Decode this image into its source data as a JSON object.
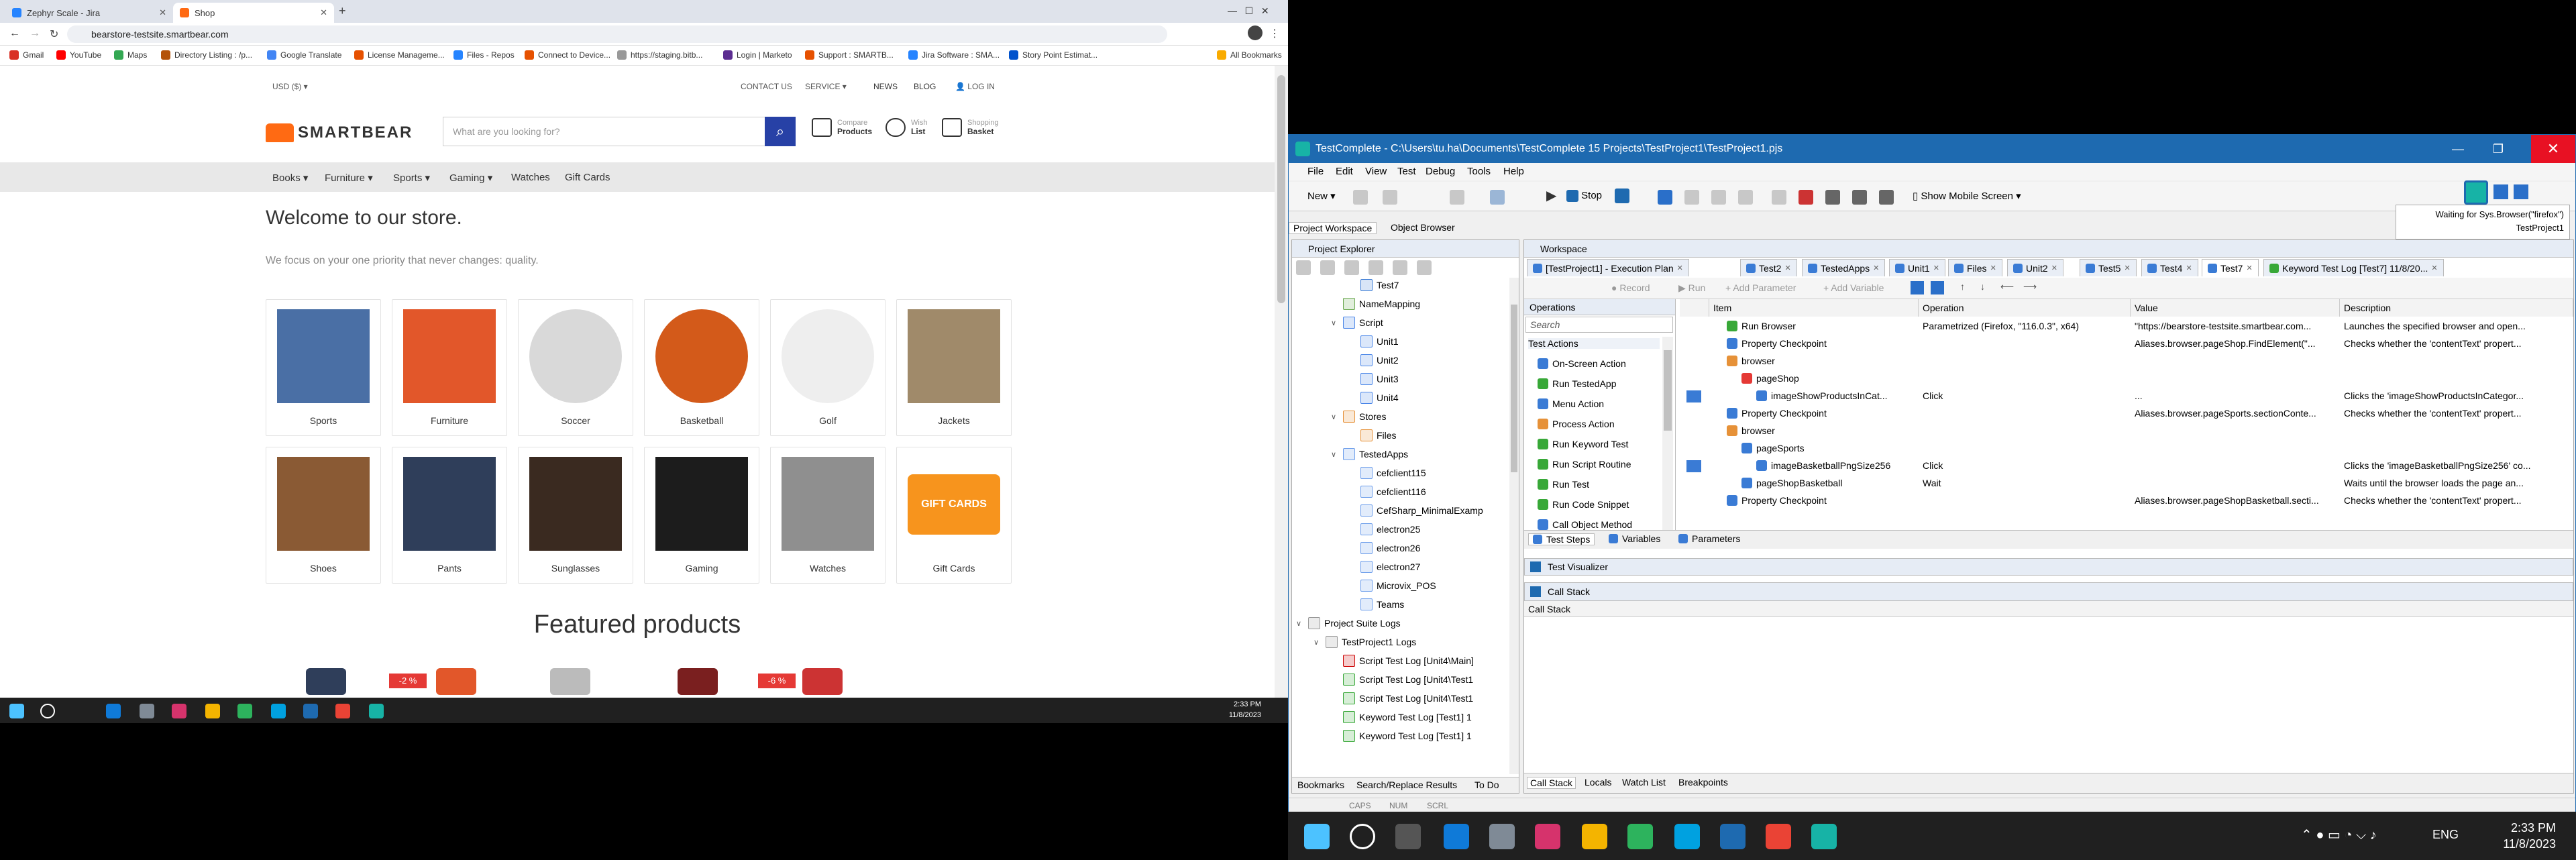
{
  "left": {
    "tabs": [
      {
        "label": "Zephyr Scale - Jira"
      },
      {
        "label": "Shop"
      }
    ],
    "url": "bearstore-testsite.smartbear.com",
    "bookmarks": [
      "Gmail",
      "YouTube",
      "Maps",
      "Directory Listing : /p...",
      "Google Translate",
      "License Manageme...",
      "Files - Repos",
      "Connect to Device...",
      "https://staging.bitb...",
      "Login | Marketo",
      "Support : SMARTB...",
      "Jira Software : SMA...",
      "Story Point Estimat..."
    ],
    "all_bookmarks": "All Bookmarks",
    "topbar": {
      "currency": "USD ($)",
      "contact": "CONTACT US",
      "service": "SERVICE",
      "news": "NEWS",
      "blog": "BLOG",
      "login": "LOG IN"
    },
    "logo": "SMARTBEAR",
    "search_placeholder": "What are you looking for?",
    "header_icons": [
      {
        "top": "Compare",
        "bottom": "Products"
      },
      {
        "top": "Wish",
        "bottom": "List"
      },
      {
        "top": "Shopping",
        "bottom": "Basket"
      }
    ],
    "nav": [
      "Books",
      "Furniture",
      "Sports",
      "Gaming",
      "Watches",
      "Gift Cards"
    ],
    "welcome": "Welcome to our store.",
    "subtitle": "We focus on your one priority that never changes: quality.",
    "categories": [
      {
        "label": "Sports",
        "color": "#4a6fa5"
      },
      {
        "label": "Furniture",
        "color": "#e2572a"
      },
      {
        "label": "Soccer",
        "color": "#d9d9d9"
      },
      {
        "label": "Basketball",
        "color": "#d35a1a"
      },
      {
        "label": "Golf",
        "color": "#eeeeee"
      },
      {
        "label": "Jackets",
        "color": "#a08a6a"
      },
      {
        "label": "Shoes",
        "color": "#8a5a34"
      },
      {
        "label": "Pants",
        "color": "#2f3e5a"
      },
      {
        "label": "Sunglasses",
        "color": "#3a2a20"
      },
      {
        "label": "Gaming",
        "color": "#1c1c1c"
      },
      {
        "label": "Watches",
        "color": "#8f8f8f"
      },
      {
        "label": "Gift Cards",
        "color": "#f7941d"
      }
    ],
    "gift_card_text": "GIFT CARDS",
    "featured": "Featured products",
    "discounts": [
      "-2 %",
      "-6 %"
    ],
    "taskbar_time": "2:33 PM",
    "taskbar_date": "11/8/2023"
  },
  "right": {
    "title": "TestComplete - C:\\Users\\tu.ha\\Documents\\TestComplete 15 Projects\\TestProject1\\TestProject1.pjs",
    "menu": [
      "File",
      "Edit",
      "View",
      "Test",
      "Debug",
      "Tools",
      "Help"
    ],
    "toolbar": {
      "new": "New",
      "stop": "Stop",
      "mobile": "Show Mobile Screen"
    },
    "hint_line1": "Waiting for Sys.Browser(\"firefox\")",
    "hint_line2": "TestProject1",
    "ws_tabs": [
      "Project Workspace",
      "Object Browser"
    ],
    "explorer_title": "Project Explorer",
    "workspace_title": "Workspace",
    "tree": [
      {
        "label": "Test7",
        "indent": 3,
        "tg": "",
        "color": "#3a7bd5"
      },
      {
        "label": "NameMapping",
        "indent": 2,
        "tg": "",
        "color": "#6aa84f"
      },
      {
        "label": "Script",
        "indent": 2,
        "tg": "∨",
        "color": "#4a86e8"
      },
      {
        "label": "Unit1",
        "indent": 3,
        "tg": "",
        "color": "#4a86e8"
      },
      {
        "label": "Unit2",
        "indent": 3,
        "tg": "",
        "color": "#4a86e8"
      },
      {
        "label": "Unit3",
        "indent": 3,
        "tg": "",
        "color": "#4a86e8"
      },
      {
        "label": "Unit4",
        "indent": 3,
        "tg": "",
        "color": "#4a86e8"
      },
      {
        "label": "Stores",
        "indent": 2,
        "tg": "∨",
        "color": "#e69138"
      },
      {
        "label": "Files",
        "indent": 3,
        "tg": "",
        "color": "#e69138"
      },
      {
        "label": "TestedApps",
        "indent": 2,
        "tg": "∨",
        "color": "#6d9eeb"
      },
      {
        "label": "cefclient115",
        "indent": 3,
        "tg": "",
        "color": "#6d9eeb"
      },
      {
        "label": "cefclient116",
        "indent": 3,
        "tg": "",
        "color": "#6d9eeb"
      },
      {
        "label": "CefSharp_MinimalExamp",
        "indent": 3,
        "tg": "",
        "color": "#6d9eeb"
      },
      {
        "label": "electron25",
        "indent": 3,
        "tg": "",
        "color": "#6d9eeb"
      },
      {
        "label": "electron26",
        "indent": 3,
        "tg": "",
        "color": "#6d9eeb"
      },
      {
        "label": "electron27",
        "indent": 3,
        "tg": "",
        "color": "#6d9eeb"
      },
      {
        "label": "Microvix_POS",
        "indent": 3,
        "tg": "",
        "color": "#6d9eeb"
      },
      {
        "label": "Teams",
        "indent": 3,
        "tg": "",
        "color": "#6d9eeb"
      },
      {
        "label": "Project Suite Logs",
        "indent": 0,
        "tg": "∨",
        "color": "#999999"
      },
      {
        "label": "TestProject1 Logs",
        "indent": 1,
        "tg": "∨",
        "color": "#999999"
      },
      {
        "label": "Script Test Log [Unit4\\Main]",
        "indent": 2,
        "tg": "",
        "color": "#cc0000"
      },
      {
        "label": "Script Test Log [Unit4\\Test1",
        "indent": 2,
        "tg": "",
        "color": "#38a838"
      },
      {
        "label": "Script Test Log [Unit4\\Test1",
        "indent": 2,
        "tg": "",
        "color": "#38a838"
      },
      {
        "label": "Keyword Test Log [Test1] 1",
        "indent": 2,
        "tg": "",
        "color": "#38a838"
      },
      {
        "label": "Keyword Test Log [Test1] 1",
        "indent": 2,
        "tg": "",
        "color": "#38a838"
      }
    ],
    "explorer_bottom_tabs": [
      "Bookmarks",
      "Search/Replace Results",
      "To Do"
    ],
    "doc_tabs": [
      "[TestProject1] - Execution Plan",
      "Test2",
      "TestedApps",
      "Unit1",
      "Files",
      "Unit2",
      "Test5",
      "Test4",
      "Test7",
      "Keyword Test Log [Test7] 11/8/20..."
    ],
    "kt_toolbar": [
      "Record",
      "Run",
      "Add Parameter",
      "Add Variable"
    ],
    "ops_title": "Operations",
    "ops_search": "Search",
    "ops": [
      {
        "label": "Test Actions",
        "group": true,
        "color": ""
      },
      {
        "label": "On-Screen Action",
        "group": false,
        "color": "#3a7bd5"
      },
      {
        "label": "Run TestedApp",
        "group": false,
        "color": "#38a838"
      },
      {
        "label": "Menu Action",
        "group": false,
        "color": "#3a7bd5"
      },
      {
        "label": "Process Action",
        "group": false,
        "color": "#e69138"
      },
      {
        "label": "Run Keyword Test",
        "group": false,
        "color": "#38a838"
      },
      {
        "label": "Run Script Routine",
        "group": false,
        "color": "#38a838"
      },
      {
        "label": "Run Test",
        "group": false,
        "color": "#38a838"
      },
      {
        "label": "Run Code Snippet",
        "group": false,
        "color": "#38a838"
      },
      {
        "label": "Call Object Method",
        "group": false,
        "color": "#3a7bd5"
      }
    ],
    "grid_headers": [
      "Item",
      "Operation",
      "Value",
      "Description"
    ],
    "grid_rows": [
      {
        "item": "Run Browser",
        "indent": 0,
        "op": "Parametrized (Firefox, \"116.0.3\", x64)",
        "val": "\"https://bearstore-testsite.smartbear.com...",
        "desc": "Launches the specified browser and open...",
        "color": "#38a838",
        "thumb": false
      },
      {
        "item": "Property Checkpoint",
        "indent": 0,
        "op": "",
        "val": "Aliases.browser.pageShop.FindElement(\"...",
        "desc": "Checks whether the 'contentText' propert...",
        "color": "#3a7bd5",
        "thumb": false
      },
      {
        "item": "browser",
        "indent": 0,
        "op": "",
        "val": "",
        "desc": "",
        "color": "#e69138",
        "thumb": false
      },
      {
        "item": "pageShop",
        "indent": 1,
        "op": "",
        "val": "",
        "desc": "",
        "color": "#e53935",
        "thumb": false
      },
      {
        "item": "imageShowProductsInCat...",
        "indent": 2,
        "op": "Click",
        "val": "...",
        "desc": "Clicks the 'imageShowProductsInCategor...",
        "color": "#3a7bd5",
        "thumb": true
      },
      {
        "item": "Property Checkpoint",
        "indent": 0,
        "op": "",
        "val": "Aliases.browser.pageSports.sectionConte...",
        "desc": "Checks whether the 'contentText' propert...",
        "color": "#3a7bd5",
        "thumb": false
      },
      {
        "item": "browser",
        "indent": 0,
        "op": "",
        "val": "",
        "desc": "",
        "color": "#e69138",
        "thumb": false
      },
      {
        "item": "pageSports",
        "indent": 1,
        "op": "",
        "val": "",
        "desc": "",
        "color": "#3a7bd5",
        "thumb": false
      },
      {
        "item": "imageBasketballPngSize256",
        "indent": 2,
        "op": "Click",
        "val": "",
        "desc": "Clicks the 'imageBasketballPngSize256' co...",
        "color": "#3a7bd5",
        "thumb": true
      },
      {
        "item": "pageShopBasketball",
        "indent": 1,
        "op": "Wait",
        "val": "",
        "desc": "Waits until the browser loads the page an...",
        "color": "#3a7bd5",
        "thumb": false
      },
      {
        "item": "Property Checkpoint",
        "indent": 0,
        "op": "",
        "val": "Aliases.browser.pageShopBasketball.secti...",
        "desc": "Checks whether the 'contentText' propert...",
        "color": "#3a7bd5",
        "thumb": false
      }
    ],
    "kt_bottom_tabs": [
      "Test Steps",
      "Variables",
      "Parameters"
    ],
    "visualizer": "Test Visualizer",
    "callstack_title": "Call Stack",
    "callstack_col": "Call Stack",
    "debug_tabs": [
      "Call Stack",
      "Locals",
      "Watch List",
      "Breakpoints"
    ],
    "status": [
      "CAPS",
      "NUM",
      "SCRL"
    ]
  },
  "taskbar": {
    "lang": "ENG",
    "time": "2:33 PM",
    "date": "11/8/2023"
  }
}
